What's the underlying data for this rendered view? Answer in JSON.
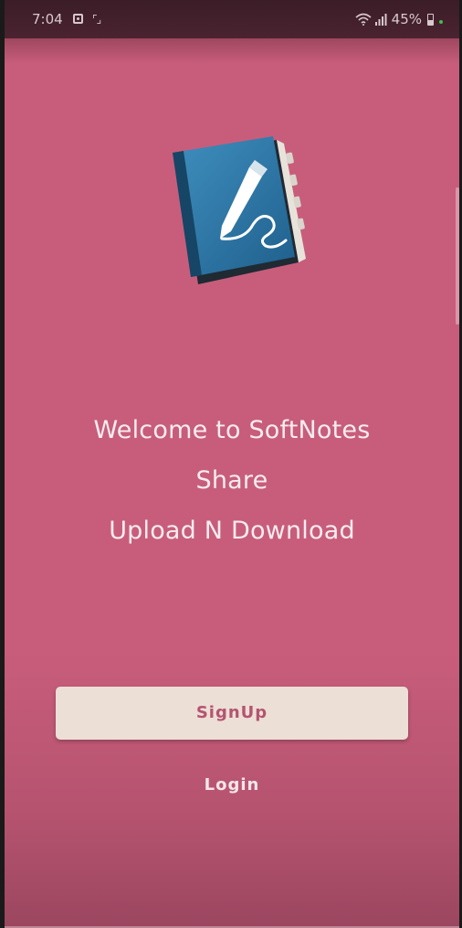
{
  "status_bar": {
    "time": "7:04",
    "battery": "45%"
  },
  "icons": {
    "logo": "notebook-pen-icon",
    "status": [
      "photo-icon",
      "screen-capture-icon",
      "wifi-icon",
      "signal-icon",
      "battery-icon"
    ]
  },
  "welcome": {
    "line1": "Welcome to SoftNotes",
    "line2": "Share",
    "line3": "Upload N Download"
  },
  "actions": {
    "signup_label": "SignUp",
    "login_label": "Login"
  },
  "colors": {
    "background": "#c85d7b",
    "signup_button": "#ecdfd6",
    "signup_text": "#b45471",
    "text": "#f6ecef"
  }
}
